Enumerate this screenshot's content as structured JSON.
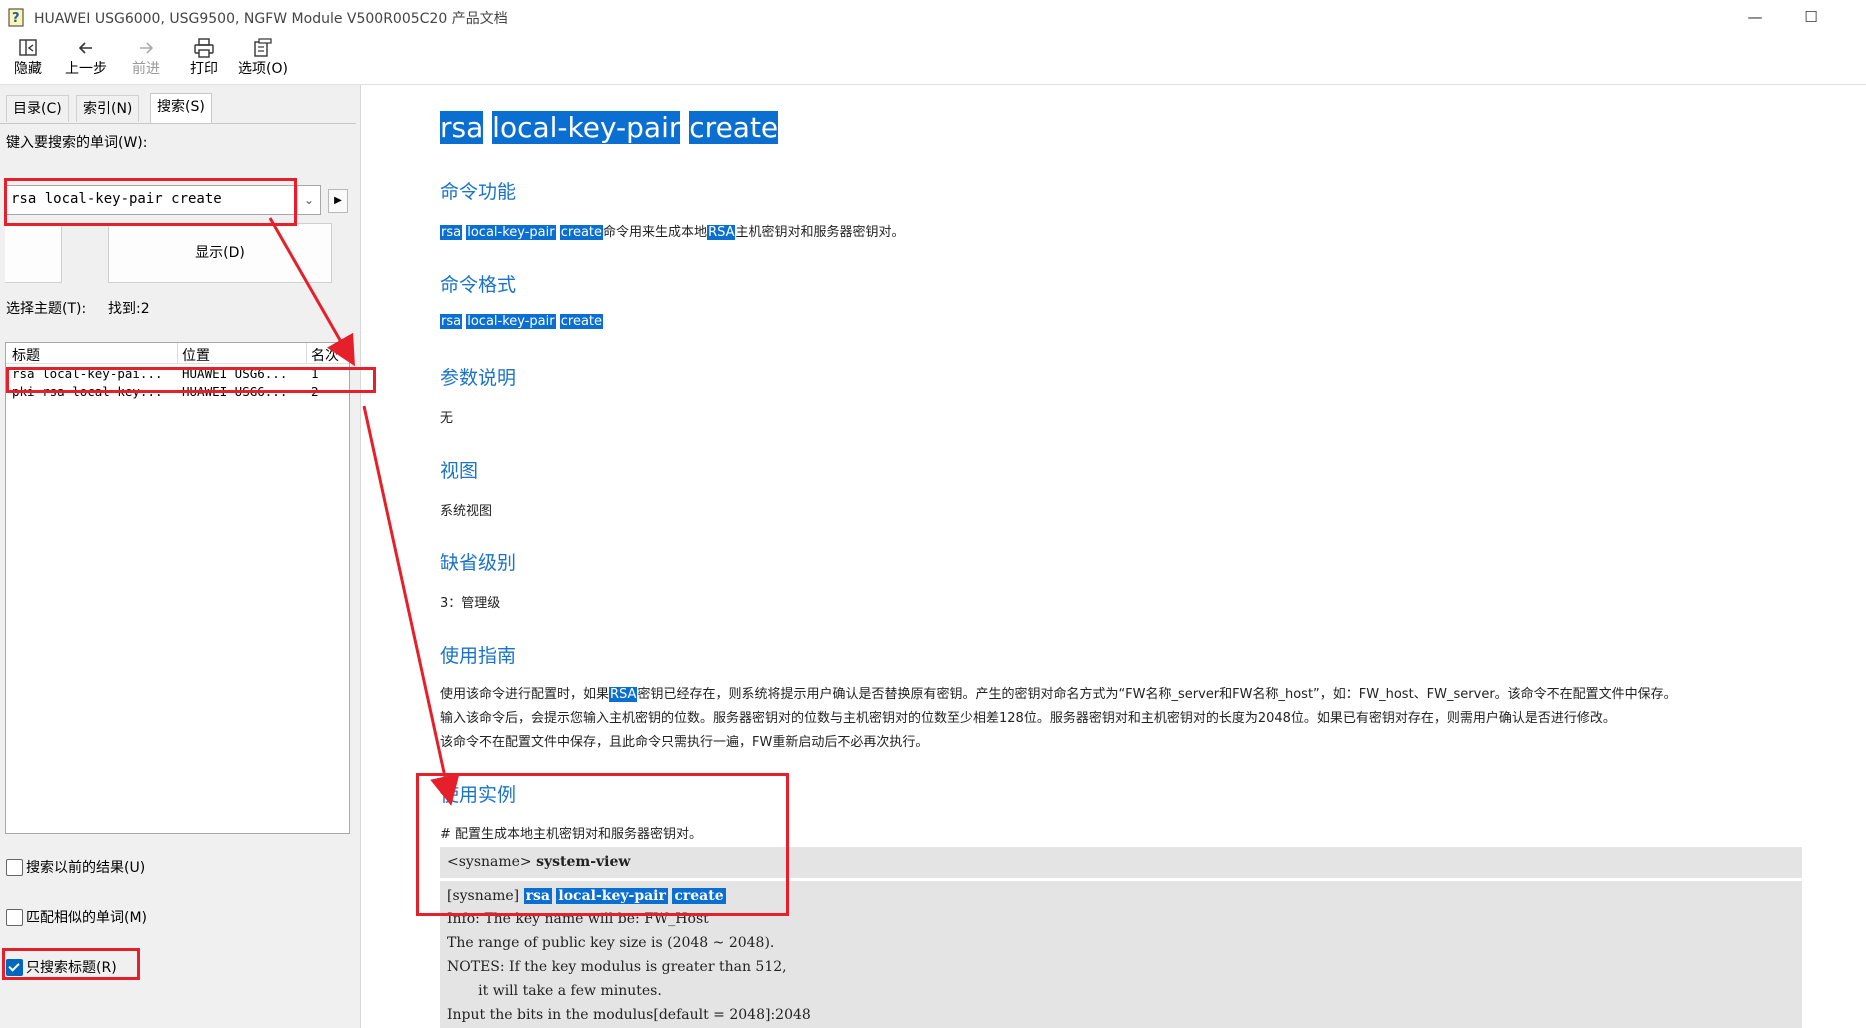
{
  "window": {
    "title": "HUAWEI USG6000, USG9500, NGFW Module V500R005C20 产品文档",
    "minimize": "—",
    "maximize": "☐"
  },
  "toolbar": {
    "hide": "隐藏",
    "back": "上一步",
    "forward": "前进",
    "print": "打印",
    "options": "选项(O)"
  },
  "nav": {
    "tabs": [
      "目录(C)",
      "索引(N)",
      "搜索(S)"
    ],
    "search_label": "键入要搜索的单词(W):",
    "search_value": "rsa local-key-pair create",
    "show_button": "显示(D)",
    "select_topic_label": "选择主题(T):",
    "found": "找到:2",
    "columns": [
      "标题",
      "位置",
      "名次"
    ],
    "rows": [
      {
        "title": "rsa local-key-pai...",
        "location": "HUAWEI USG6...",
        "rank": "1"
      },
      {
        "title": "pki rsa local-key...",
        "location": "HUAWEI USG6...",
        "rank": "2"
      }
    ],
    "checkboxes": [
      {
        "label": "搜索以前的结果(U)",
        "checked": false
      },
      {
        "label": "匹配相似的单词(M)",
        "checked": false
      },
      {
        "label": "只搜索标题(R)",
        "checked": true
      }
    ]
  },
  "doc": {
    "title_words": [
      "rsa",
      "local-key-pair",
      "create"
    ],
    "sections": {
      "function": "命令功能",
      "format": "命令格式",
      "params": "参数说明",
      "view": "视图",
      "level": "缺省级别",
      "guide": "使用指南",
      "example": "使用实例"
    },
    "function_suffix": "命令用来生成本地",
    "function_rsa": "RSA",
    "function_end": "主机密钥对和服务器密钥对。",
    "params_text": "无",
    "view_text": "系统视图",
    "level_text": "3：管理级",
    "guide_1a": "使用该命令进行配置时，如果",
    "guide_1_rsa": "RSA",
    "guide_1b": "密钥已经存在，则系统将提示用户确认是否替换原有密钥。产生的密钥对命名方式为“FW名称_server和FW名称_host”，如：FW_host、FW_server。该命令不在配置文件中保存。",
    "guide_2": "输入该命令后，会提示您输入主机密钥的位数。服务器密钥对的位数与主机密钥对的位数至少相差128位。服务器密钥对和主机密钥对的长度为2048位。如果已有密钥对存在，则需用户确认是否进行修改。",
    "guide_3": "该命令不在配置文件中保存，且此命令只需执行一遍，FW重新启动后不必再次执行。",
    "example_comment": "# 配置生成本地主机密钥对和服务器密钥对。",
    "code_prompt1": "<sysname>",
    "code_cmd1": "system-view",
    "code_prompt2": "[sysname]",
    "code_lines": [
      "Info: The key name will be: FW_Host",
      "The range of public key size is (2048 ~ 2048).",
      "NOTES: If the key modulus is greater than 512,",
      "       it will take a few minutes.",
      "Input the bits in the modulus[default = 2048]:2048"
    ]
  },
  "colors": {
    "highlight": "#0a6fd0",
    "heading": "#1a73c8",
    "annotation": "#e5202a"
  }
}
